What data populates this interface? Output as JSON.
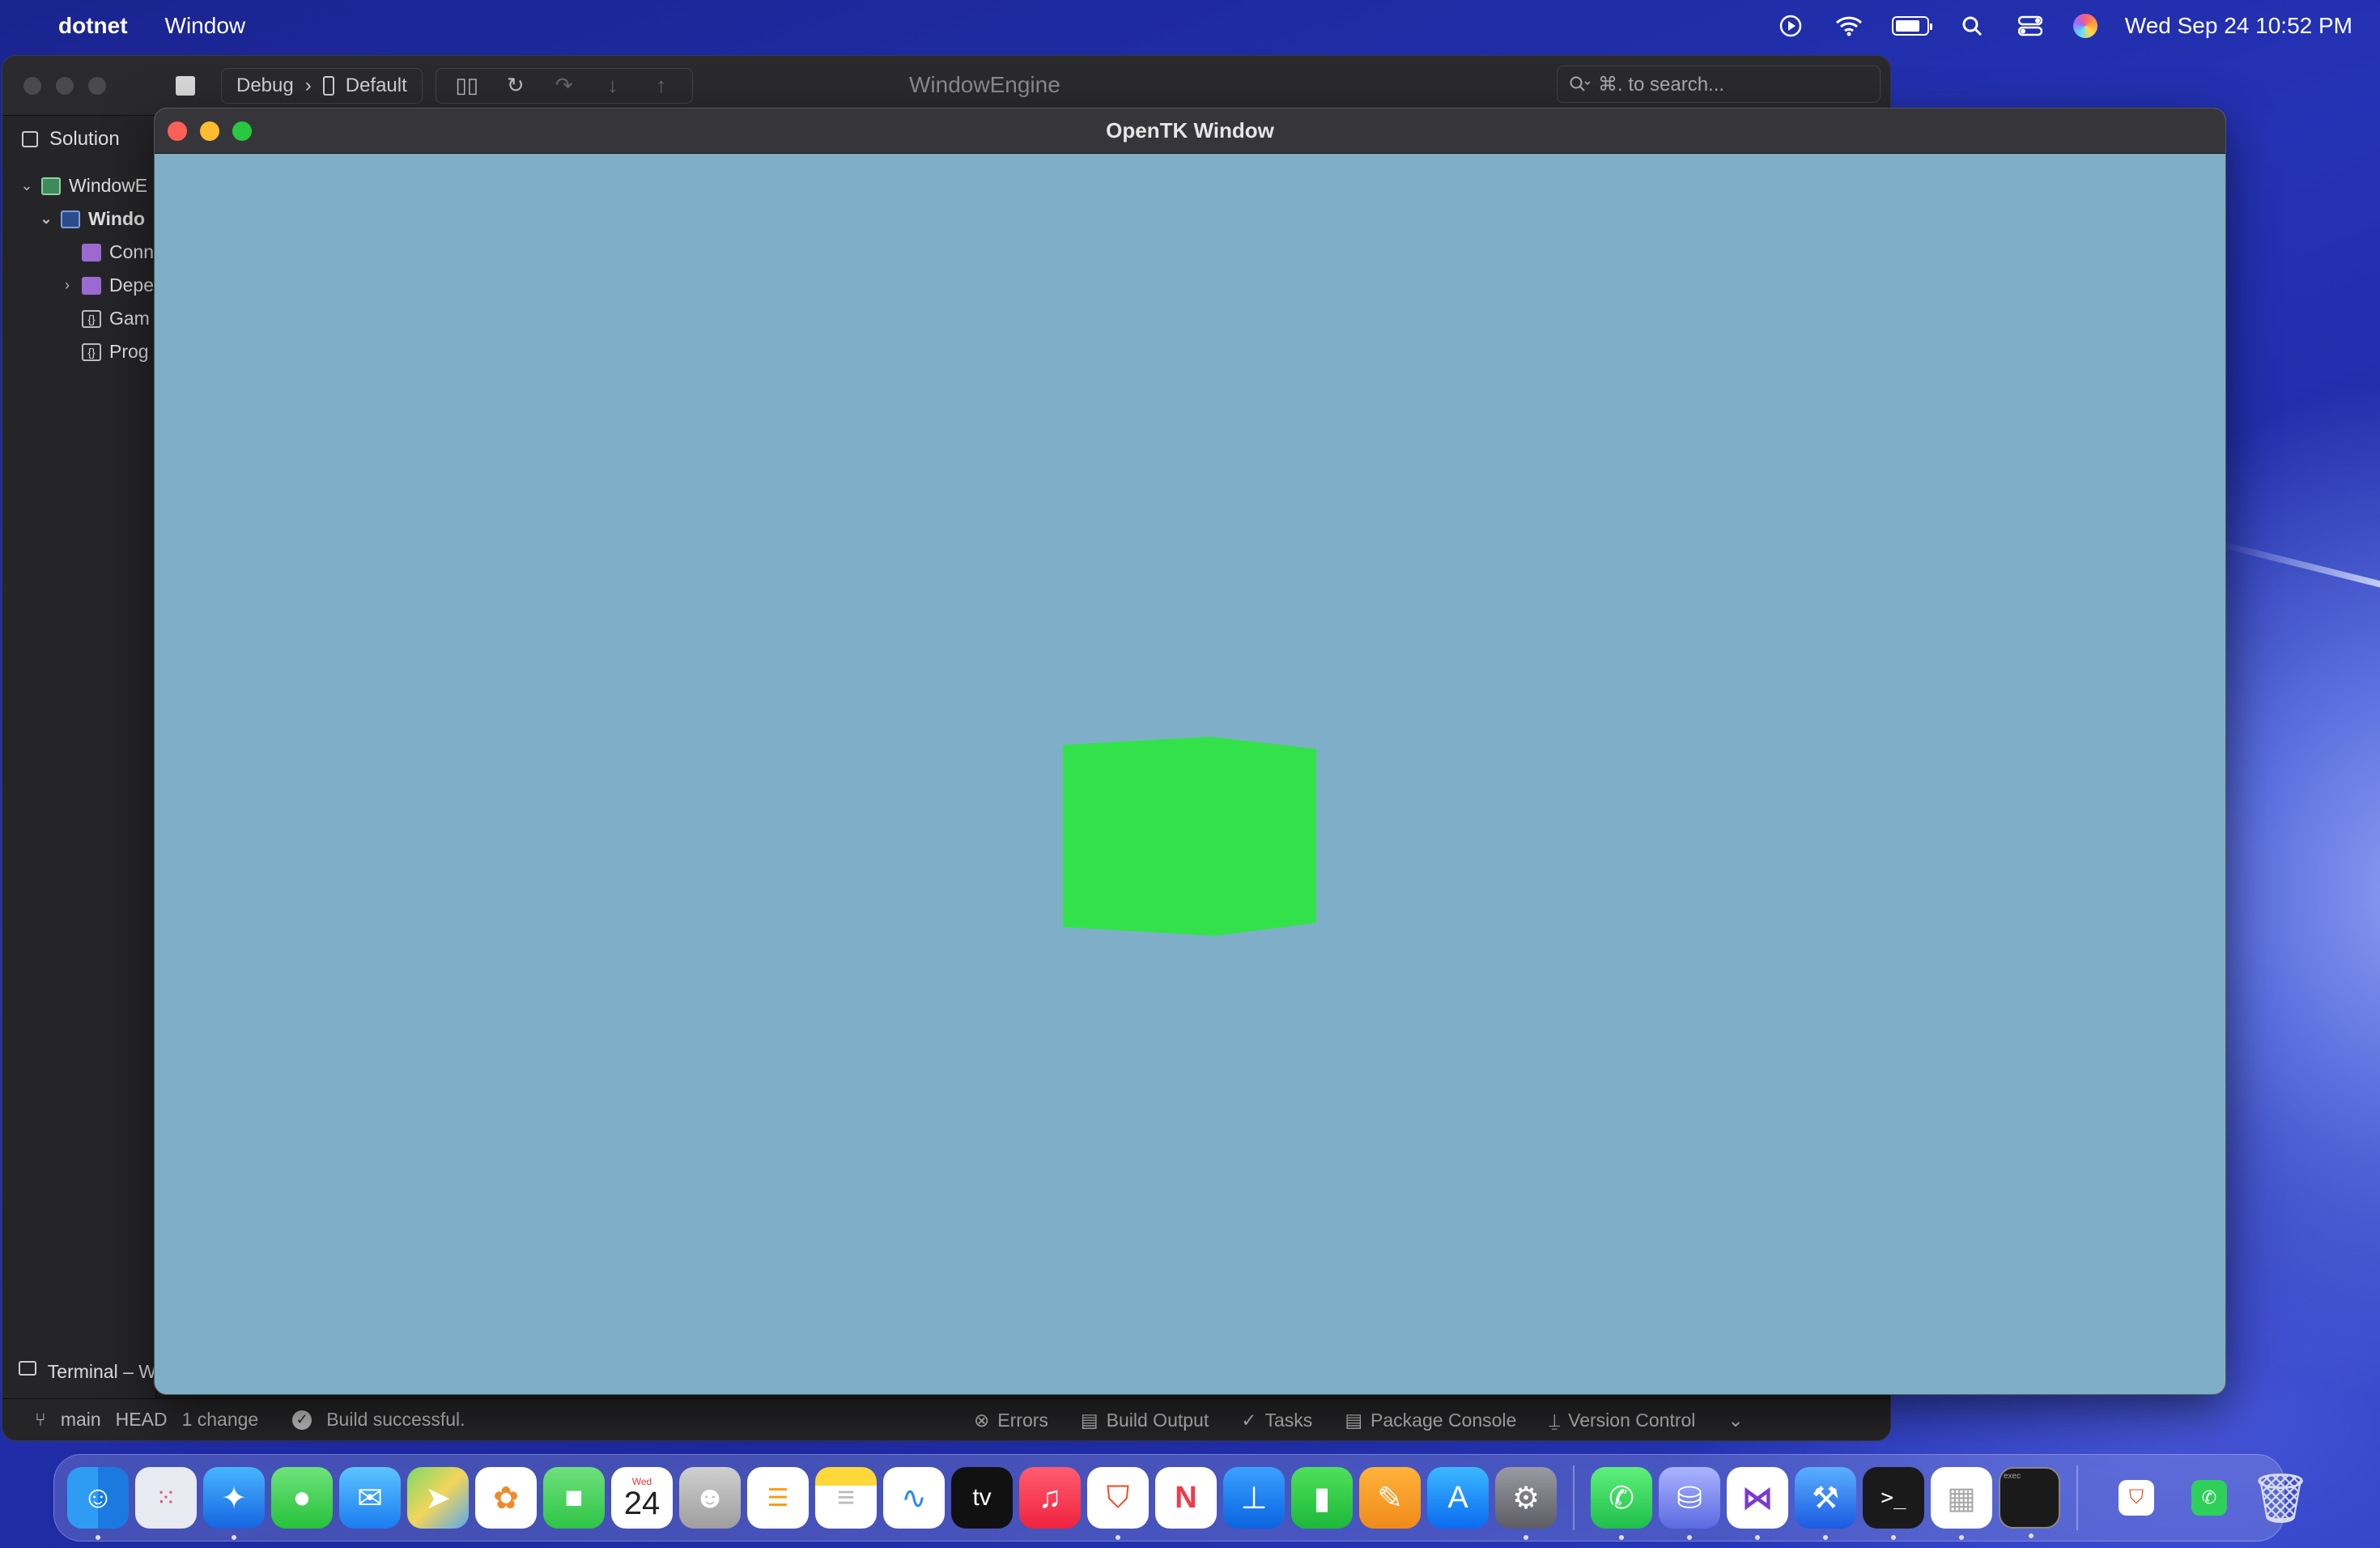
{
  "menubar": {
    "app_name": "dotnet",
    "menu": "Window",
    "date_time": "Wed Sep 24  10:52 PM"
  },
  "ide": {
    "config": "Debug",
    "target": "Default",
    "title": "WindowEngine",
    "search_placeholder": "⌘. to search...",
    "sidebar_title": "Solution",
    "tree": [
      "WindowE",
      "Windo",
      "Conn",
      "Depe",
      "Gam",
      "Prog"
    ],
    "terminal": "Terminal – W",
    "status": {
      "branch": "main",
      "head": "HEAD",
      "changes": "1 change",
      "build": "Build successful."
    },
    "bottom_tabs": [
      "Errors",
      "Build Output",
      "Tasks",
      "Package Console",
      "Version Control"
    ]
  },
  "gl_window": {
    "title": "OpenTK Window",
    "clear_color": "#7fafc8",
    "cube_color": "#33e24a"
  },
  "dock": {
    "calendar_month": "Wed",
    "calendar_day": "24",
    "tv_label": "tv",
    "exec_label": "exec"
  }
}
